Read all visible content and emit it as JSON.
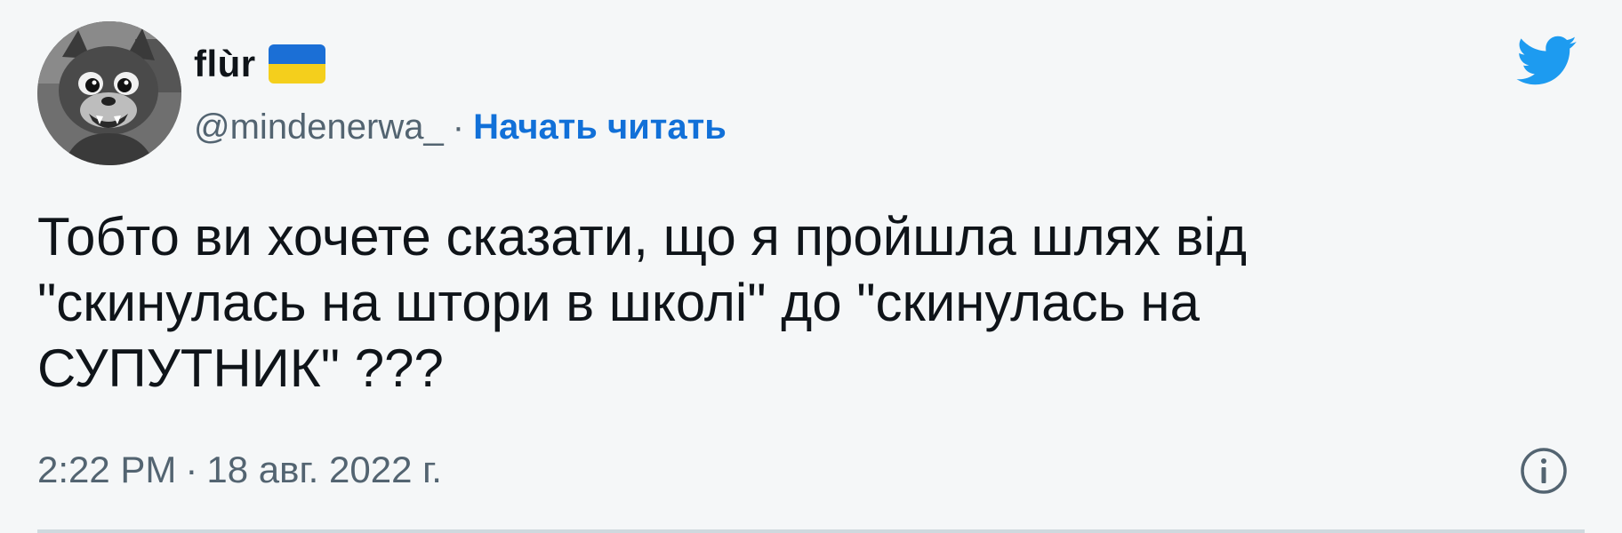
{
  "author": {
    "display_name": "flùr",
    "flag_icon": "ukraine-flag-icon",
    "handle": "@mindenerwa_",
    "separator": "·",
    "follow_label": "Начать читать"
  },
  "tweet": {
    "text": "Тобто ви хочете сказати, що я пройшла шлях від\n\"скинулась на штори в школі\" до \"скинулась на\nСУПУТНИК\" ???",
    "time": "2:22 PM",
    "separator": "·",
    "date": "18 авг. 2022 г."
  },
  "icons": {
    "brand": "twitter-bird-icon",
    "info": "info-icon"
  },
  "colors": {
    "background": "#f5f7f8",
    "text": "#0f1419",
    "muted": "#536471",
    "link": "#1170d8",
    "twitter_blue": "#1d9bf0",
    "flag_blue": "#1b6fd6",
    "flag_yellow": "#f4cf1c"
  }
}
